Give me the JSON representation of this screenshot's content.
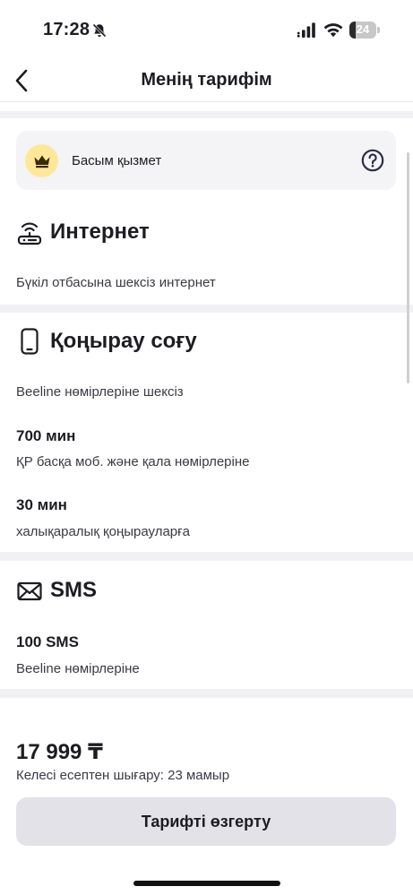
{
  "status_bar": {
    "time": "17:28",
    "battery": "24",
    "battery_level": 0.24
  },
  "header": {
    "title": "Менің тарифім"
  },
  "priority": {
    "label": "Басым қызмет"
  },
  "internet": {
    "title": "Интернет",
    "description": "Бүкіл отбасына шексіз интернет"
  },
  "calls": {
    "title": "Қоңырау соғу",
    "description": "Beeline нөмірлеріне шексіз",
    "packages": [
      {
        "amount": "700 мин",
        "description": "ҚР басқа моб. және қала нөмірлеріне"
      },
      {
        "amount": "30 мин",
        "description": "халықаралық қоңырауларға"
      }
    ]
  },
  "sms": {
    "title": "SMS",
    "amount": "100 SMS",
    "description": "Beeline нөмірлеріне"
  },
  "footer": {
    "price": "17 999 ₸",
    "next_bill": "Келесі есептен шығару: 23 мамыр",
    "change_button": "Тарифті өзгерту"
  },
  "colors": {
    "accent_yellow": "#fde89a",
    "button_gray": "#e2e2e8",
    "card_bg": "#f4f4f6"
  }
}
